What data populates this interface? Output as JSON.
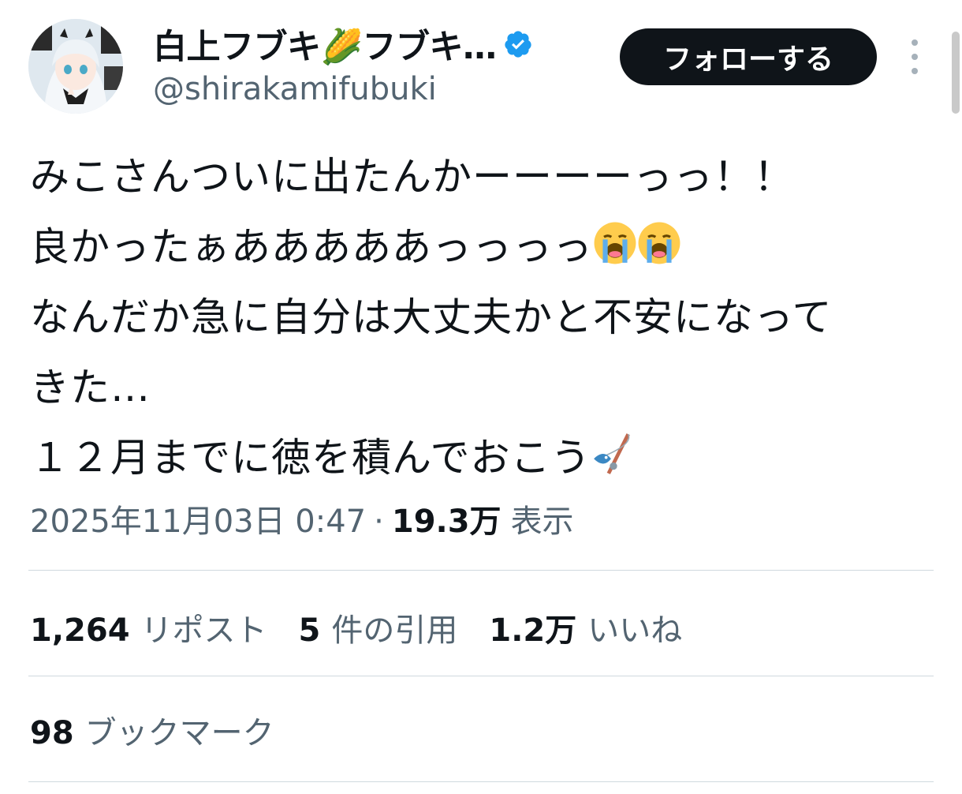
{
  "header": {
    "display_name": "白上フブキ🌽フブキ…",
    "handle": "@shirakamifubuki",
    "follow_label": "フォローする",
    "avatar_icon": "anime-avatar-icon",
    "verified_icon": "verified-badge-icon",
    "more_icon": "more-vertical-icon"
  },
  "tweet": {
    "lines": [
      "みこさんついに出たんかーーーーっっ！！",
      "良かったぁあああああっっっっ",
      "なんだか急に自分は大丈夫かと不安になって",
      "きた…",
      "１２月までに徳を積んでおこう"
    ],
    "emojis": [
      "loudly-crying-face-icon",
      "loudly-crying-face-icon",
      "fishing-pole-icon"
    ]
  },
  "meta": {
    "timestamp": "2025年11月03日 0:47",
    "separator": "·",
    "views_count": "19.3万",
    "views_label": "表示"
  },
  "stats": {
    "reposts_count": "1,264",
    "reposts_label": "リポスト",
    "quotes_count": "5",
    "quotes_label": "件の引用",
    "likes_count": "1.2万",
    "likes_label": "いいね",
    "bookmarks_count": "98",
    "bookmarks_label": "ブックマーク"
  },
  "colors": {
    "text_primary": "#0f1419",
    "text_secondary": "#536471",
    "divider": "#cfd9de",
    "verified_blue": "#1d9bf0",
    "follow_bg": "#0f1419"
  }
}
